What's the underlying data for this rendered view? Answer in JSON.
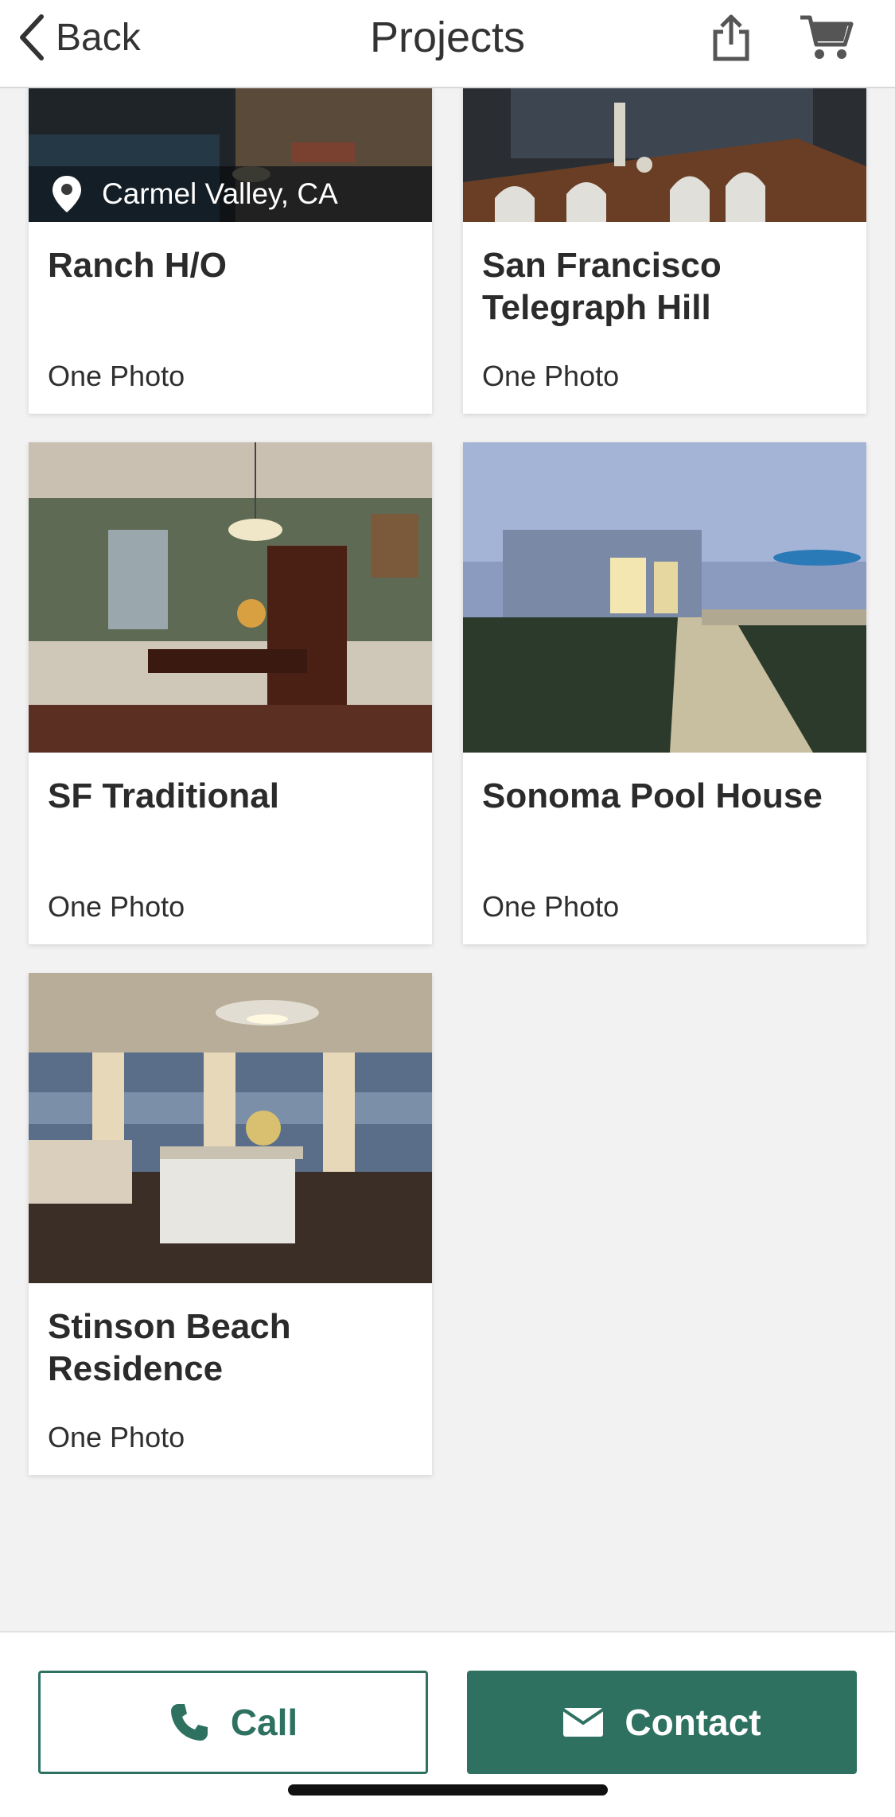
{
  "header": {
    "back_label": "Back",
    "title": "Projects",
    "share_icon": "share-icon",
    "cart_icon": "cart-icon"
  },
  "projects": [
    {
      "name": "Ranch H/O",
      "photos": "One Photo",
      "location": "Carmel Valley, CA"
    },
    {
      "name": "San Francisco Telegraph Hill",
      "photos": "One Photo"
    },
    {
      "name": "SF Traditional",
      "photos": "One Photo"
    },
    {
      "name": "Sonoma Pool House",
      "photos": "One Photo"
    },
    {
      "name": "Stinson Beach Residence",
      "photos": "One Photo"
    }
  ],
  "actions": {
    "call_label": "Call",
    "contact_label": "Contact",
    "accent_color": "#2e7161"
  }
}
